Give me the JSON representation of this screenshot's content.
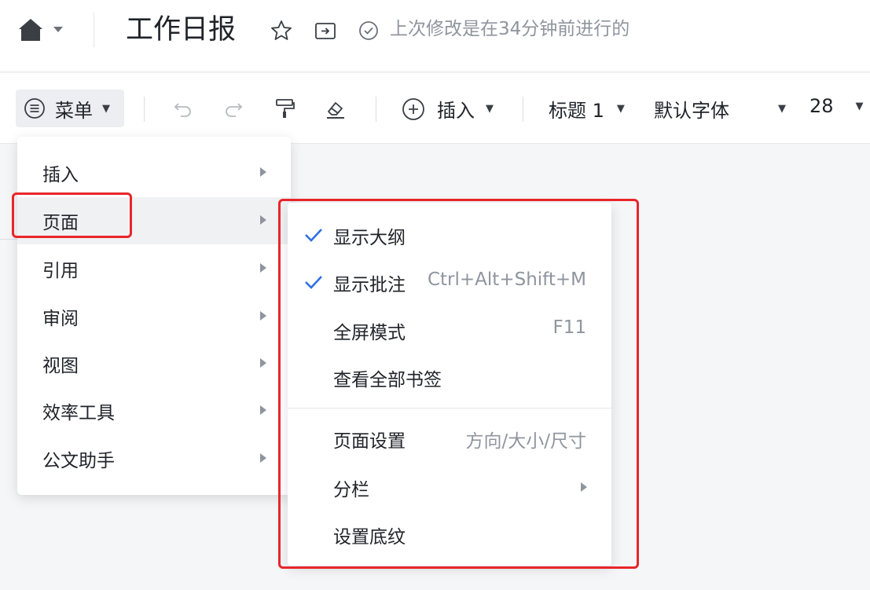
{
  "header": {
    "title": "工作日报",
    "save_status": "上次修改是在34分钟前进行的",
    "icons": [
      "home-icon",
      "star-icon",
      "move-to-folder-icon",
      "check-circle-icon"
    ]
  },
  "toolbar": {
    "menu_label": "菜单",
    "insert_label": "插入",
    "heading_label": "标题 1",
    "font_label": "默认字体",
    "font_size": "28",
    "icons": [
      "menu-icon",
      "undo-icon",
      "redo-icon",
      "format-painter-icon",
      "eraser-icon",
      "plus-circle-icon"
    ]
  },
  "menu": {
    "items": [
      {
        "label": "插入"
      },
      {
        "label": "页面"
      },
      {
        "label": "引用"
      },
      {
        "label": "审阅"
      },
      {
        "label": "视图"
      },
      {
        "label": "效率工具"
      },
      {
        "label": "公文助手"
      }
    ],
    "active": "页面"
  },
  "submenu": {
    "items": [
      {
        "label": "显示大纲",
        "checked": true,
        "hint": ""
      },
      {
        "label": "显示批注",
        "checked": true,
        "hint": "Ctrl+Alt+Shift+M"
      },
      {
        "label": "全屏模式",
        "checked": false,
        "hint": "F11"
      },
      {
        "label": "查看全部书签",
        "checked": false,
        "hint": ""
      },
      {
        "label": "页面设置",
        "checked": false,
        "hint": "方向/大小/尺寸"
      },
      {
        "label": "分栏",
        "checked": false,
        "hint": ""
      },
      {
        "label": "设置底纹",
        "checked": false,
        "hint": ""
      }
    ]
  },
  "colors": {
    "check": "#2f6fe4",
    "highlight": "#e8262b",
    "muted_text": "#8f959e"
  }
}
